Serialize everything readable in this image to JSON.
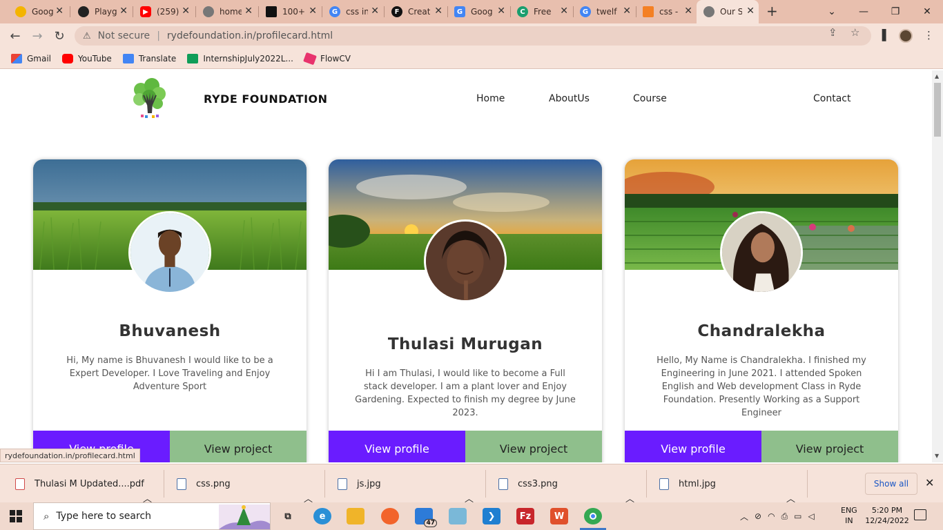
{
  "browser": {
    "tabs": [
      {
        "title": "Goog",
        "icon": "lightbulb-icon",
        "color": "#f4b400"
      },
      {
        "title": "Playg",
        "icon": "openai-icon",
        "color": "#222222"
      },
      {
        "title": "(259)",
        "icon": "youtube-icon",
        "color": "#ff0000"
      },
      {
        "title": "home",
        "icon": "globe-icon",
        "color": "#777777"
      },
      {
        "title": "100+",
        "icon": "stack-icon",
        "color": "#111111"
      },
      {
        "title": "css in",
        "icon": "google-icon",
        "color": "#4285f4"
      },
      {
        "title": "Creat",
        "icon": "f-logo-icon",
        "color": "#111111"
      },
      {
        "title": "Goog",
        "icon": "translate-icon",
        "color": "#4285f4"
      },
      {
        "title": "Free",
        "icon": "refresh-logo-icon",
        "color": "#1a9e6e"
      },
      {
        "title": "twelf",
        "icon": "google-icon",
        "color": "#4285f4"
      },
      {
        "title": "css -",
        "icon": "stackoverflow-icon",
        "color": "#f48024"
      },
      {
        "title": "Our S",
        "icon": "globe-icon",
        "color": "#777777"
      }
    ],
    "address": {
      "security": "Not secure",
      "url": "rydefoundation.in/profilecard.html"
    },
    "bookmarks": [
      {
        "label": "Gmail",
        "color": "#ea4335"
      },
      {
        "label": "YouTube",
        "color": "#ff0000"
      },
      {
        "label": "Translate",
        "color": "#4285f4"
      },
      {
        "label": "InternshipJuly2022L...",
        "color": "#0f9d58"
      },
      {
        "label": "FlowCV",
        "color": "#e8336d"
      }
    ]
  },
  "site": {
    "brand": "RYDE FOUNDATION",
    "nav": [
      "Home",
      "AboutUs",
      "Course",
      "Contact"
    ],
    "cards": [
      {
        "name": "Bhuvanesh",
        "bio": "Hi, My name is Bhuvanesh I would like to be a Expert Developer. I Love Traveling and Enjoy Adventure Sport",
        "profile_button": "View profile",
        "project_button": "View project"
      },
      {
        "name": "Thulasi Murugan",
        "bio": "Hi I am Thulasi, I would like to become a Full stack developer. I am a plant lover and Enjoy Gardening. Expected to finish my degree by June 2023.",
        "profile_button": "View profile",
        "project_button": "View project"
      },
      {
        "name": "Chandralekha",
        "bio": "Hello, My Name is Chandralekha. I finished my Engineering in June 2021. I attended Spoken English and Web development Class in Ryde Foundation. Presently Working as a Support Engineer",
        "profile_button": "View profile",
        "project_button": "View project"
      }
    ],
    "status_url": "rydefoundation.in/profilecard.html"
  },
  "downloads": {
    "items": [
      "Thulasi M Updated....pdf",
      "css.png",
      "js.jpg",
      "css3.png",
      "html.jpg"
    ],
    "show_all": "Show all"
  },
  "taskbar": {
    "search_placeholder": "Type here to search",
    "mail_badge": "47",
    "language": [
      "ENG",
      "IN"
    ],
    "time": "5:20 PM",
    "date": "12/24/2022"
  },
  "colors": {
    "accent_purple": "#6a1cff",
    "accent_green": "#8fbf8c",
    "chrome_frame": "#e8bfae"
  }
}
